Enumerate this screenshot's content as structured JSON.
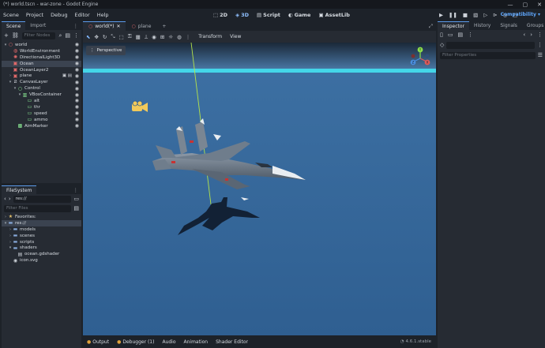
{
  "window": {
    "title": "(*) world.tscn - war-zone - Godot Engine",
    "controls": [
      "—",
      "▢",
      "✕"
    ]
  },
  "menubar": {
    "items": [
      "Scene",
      "Project",
      "Debug",
      "Editor",
      "Help"
    ],
    "modes": [
      {
        "label": "2D",
        "active": false
      },
      {
        "label": "3D",
        "active": true
      },
      {
        "label": "Script",
        "active": false
      },
      {
        "label": "Game",
        "active": false
      },
      {
        "label": "AssetLib",
        "active": false
      }
    ],
    "renderer": "Compatibility"
  },
  "scene_dock": {
    "tabs": [
      "Scene",
      "Import"
    ],
    "filter_placeholder": "Filter Nodes",
    "nodes": [
      {
        "label": "world",
        "depth": 0,
        "icon": "node3d-icon",
        "arrow": "▾",
        "color": "#e36a6a"
      },
      {
        "label": "WorldEnvironment",
        "depth": 1,
        "icon": "world-environment-icon",
        "arrow": "",
        "color": "#e36a6a"
      },
      {
        "label": "DirectionalLight3D",
        "depth": 1,
        "icon": "directional-light-icon",
        "arrow": "",
        "color": "#e36a6a"
      },
      {
        "label": "Ocean",
        "depth": 1,
        "icon": "mesh-instance-icon",
        "arrow": "",
        "color": "#e36a6a",
        "selected": true
      },
      {
        "label": "OceanLayer2",
        "depth": 1,
        "icon": "mesh-instance-icon",
        "arrow": "",
        "color": "#e36a6a"
      },
      {
        "label": "plane",
        "depth": 1,
        "icon": "scene-instance-icon",
        "arrow": "›",
        "color": "#e36a6a",
        "extra": true
      },
      {
        "label": "CanvasLayer",
        "depth": 1,
        "icon": "canvas-layer-icon",
        "arrow": "▾",
        "color": "#cdd2d9"
      },
      {
        "label": "Control",
        "depth": 2,
        "icon": "control-icon",
        "arrow": "▾",
        "color": "#8eef97"
      },
      {
        "label": "VBoxContainer",
        "depth": 3,
        "icon": "vbox-container-icon",
        "arrow": "▾",
        "color": "#8eef97"
      },
      {
        "label": "alt",
        "depth": 4,
        "icon": "label-icon",
        "arrow": "",
        "color": "#8eef97"
      },
      {
        "label": "thr",
        "depth": 4,
        "icon": "label-icon",
        "arrow": "",
        "color": "#8eef97"
      },
      {
        "label": "speed",
        "depth": 4,
        "icon": "label-icon",
        "arrow": "",
        "color": "#8eef97"
      },
      {
        "label": "ammo",
        "depth": 4,
        "icon": "label-icon",
        "arrow": "",
        "color": "#8eef97"
      },
      {
        "label": "AimMarker",
        "depth": 2,
        "icon": "texture-rect-icon",
        "arrow": "",
        "color": "#8eef97"
      }
    ]
  },
  "filesystem_dock": {
    "title": "FileSystem",
    "path": "res://",
    "filter_placeholder": "Filter Files",
    "items": [
      {
        "label": "Favorites:",
        "depth": 0,
        "icon": "star-icon",
        "arrow": "›"
      },
      {
        "label": "res://",
        "depth": 0,
        "icon": "folder-icon",
        "arrow": "▾",
        "selected": true
      },
      {
        "label": "models",
        "depth": 1,
        "icon": "folder-icon",
        "arrow": "›"
      },
      {
        "label": "scenes",
        "depth": 1,
        "icon": "folder-icon",
        "arrow": "›"
      },
      {
        "label": "scripts",
        "depth": 1,
        "icon": "folder-icon",
        "arrow": "›"
      },
      {
        "label": "shaders",
        "depth": 1,
        "icon": "folder-icon",
        "arrow": "▾"
      },
      {
        "label": "ocean.gdshader",
        "depth": 2,
        "icon": "shader-file-icon",
        "arrow": ""
      },
      {
        "label": "icon.svg",
        "depth": 1,
        "icon": "image-file-icon",
        "arrow": ""
      }
    ]
  },
  "scene_tabs": [
    {
      "label": "world(*)",
      "active": true,
      "closable": true
    },
    {
      "label": "plane",
      "active": false,
      "closable": false
    }
  ],
  "viewport_toolbar": {
    "transform_menu": "Transform",
    "view_menu": "View"
  },
  "viewport": {
    "perspective_label": "Perspective",
    "gizmo_labels": {
      "x": "X",
      "y": "Y",
      "z": "Z"
    }
  },
  "bottom_panel": {
    "tabs": [
      "Output",
      "Debugger (1)",
      "Audio",
      "Animation",
      "Shader Editor"
    ],
    "version": "4.6.1.stable"
  },
  "inspector_dock": {
    "tabs": [
      "Inspector",
      "History",
      "Signals",
      "Groups"
    ],
    "filter_placeholder": "Filter Properties"
  },
  "colors": {
    "accent": "#5c9bec",
    "sky_top": "#1a2838",
    "sky_bottom": "#4b7aa8",
    "horizon": "#44d6e8",
    "ocean_top": "#3c6fa2",
    "ocean_bottom": "#2f5f91"
  }
}
